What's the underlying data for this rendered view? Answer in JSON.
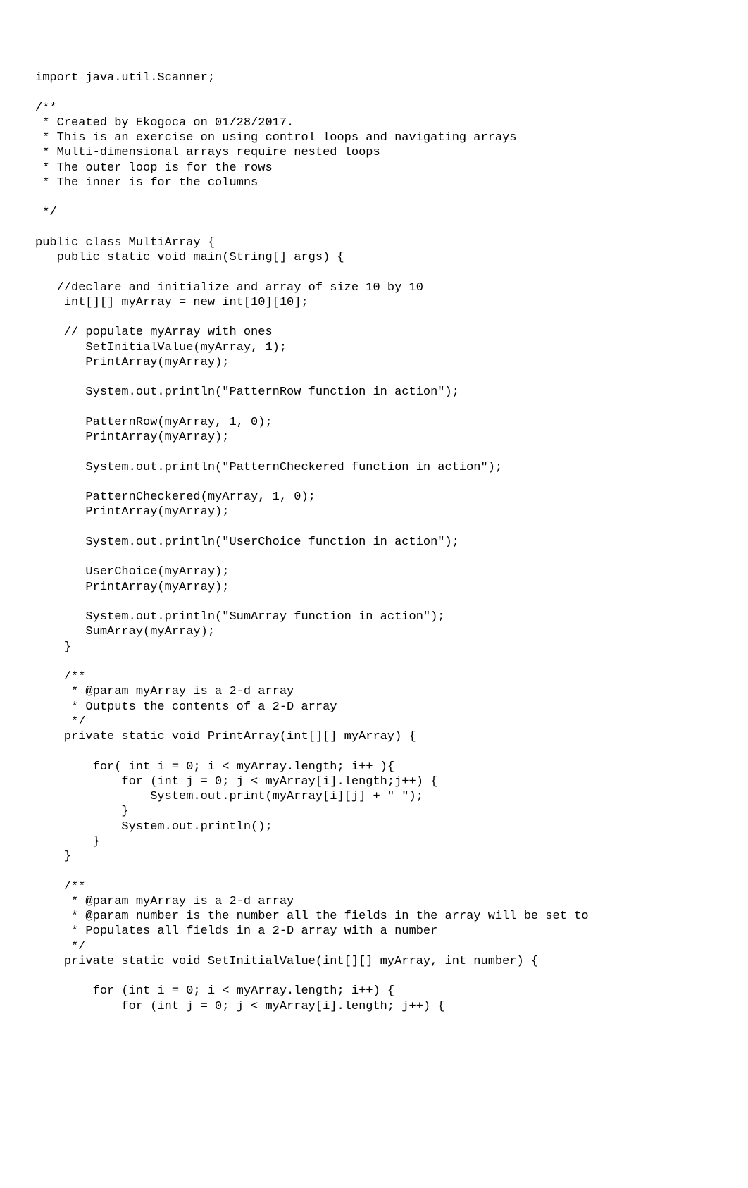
{
  "code": {
    "lines": [
      "import java.util.Scanner;",
      "",
      "/**",
      " * Created by Ekogoca on 01/28/2017.",
      " * This is an exercise on using control loops and navigating arrays",
      " * Multi-dimensional arrays require nested loops",
      " * The outer loop is for the rows",
      " * The inner is for the columns",
      "",
      " */",
      "",
      "public class MultiArray {",
      "   public static void main(String[] args) {",
      "",
      "   //declare and initialize and array of size 10 by 10",
      "    int[][] myArray = new int[10][10];",
      "",
      "    // populate myArray with ones",
      "       SetInitialValue(myArray, 1);",
      "       PrintArray(myArray);",
      "",
      "       System.out.println(\"PatternRow function in action\");",
      "",
      "       PatternRow(myArray, 1, 0);",
      "       PrintArray(myArray);",
      "",
      "       System.out.println(\"PatternCheckered function in action\");",
      "",
      "       PatternCheckered(myArray, 1, 0);",
      "       PrintArray(myArray);",
      "",
      "       System.out.println(\"UserChoice function in action\");",
      "",
      "       UserChoice(myArray);",
      "       PrintArray(myArray);",
      "",
      "       System.out.println(\"SumArray function in action\");",
      "       SumArray(myArray);",
      "    }",
      "",
      "    /**",
      "     * @param myArray is a 2-d array",
      "     * Outputs the contents of a 2-D array",
      "     */",
      "    private static void PrintArray(int[][] myArray) {",
      "",
      "        for( int i = 0; i < myArray.length; i++ ){",
      "            for (int j = 0; j < myArray[i].length;j++) {",
      "                System.out.print(myArray[i][j] + \" \");",
      "            }",
      "            System.out.println();",
      "        }",
      "    }",
      "",
      "    /**",
      "     * @param myArray is a 2-d array",
      "     * @param number is the number all the fields in the array will be set to",
      "     * Populates all fields in a 2-D array with a number",
      "     */",
      "    private static void SetInitialValue(int[][] myArray, int number) {",
      "",
      "        for (int i = 0; i < myArray.length; i++) {",
      "            for (int j = 0; j < myArray[i].length; j++) {"
    ]
  }
}
